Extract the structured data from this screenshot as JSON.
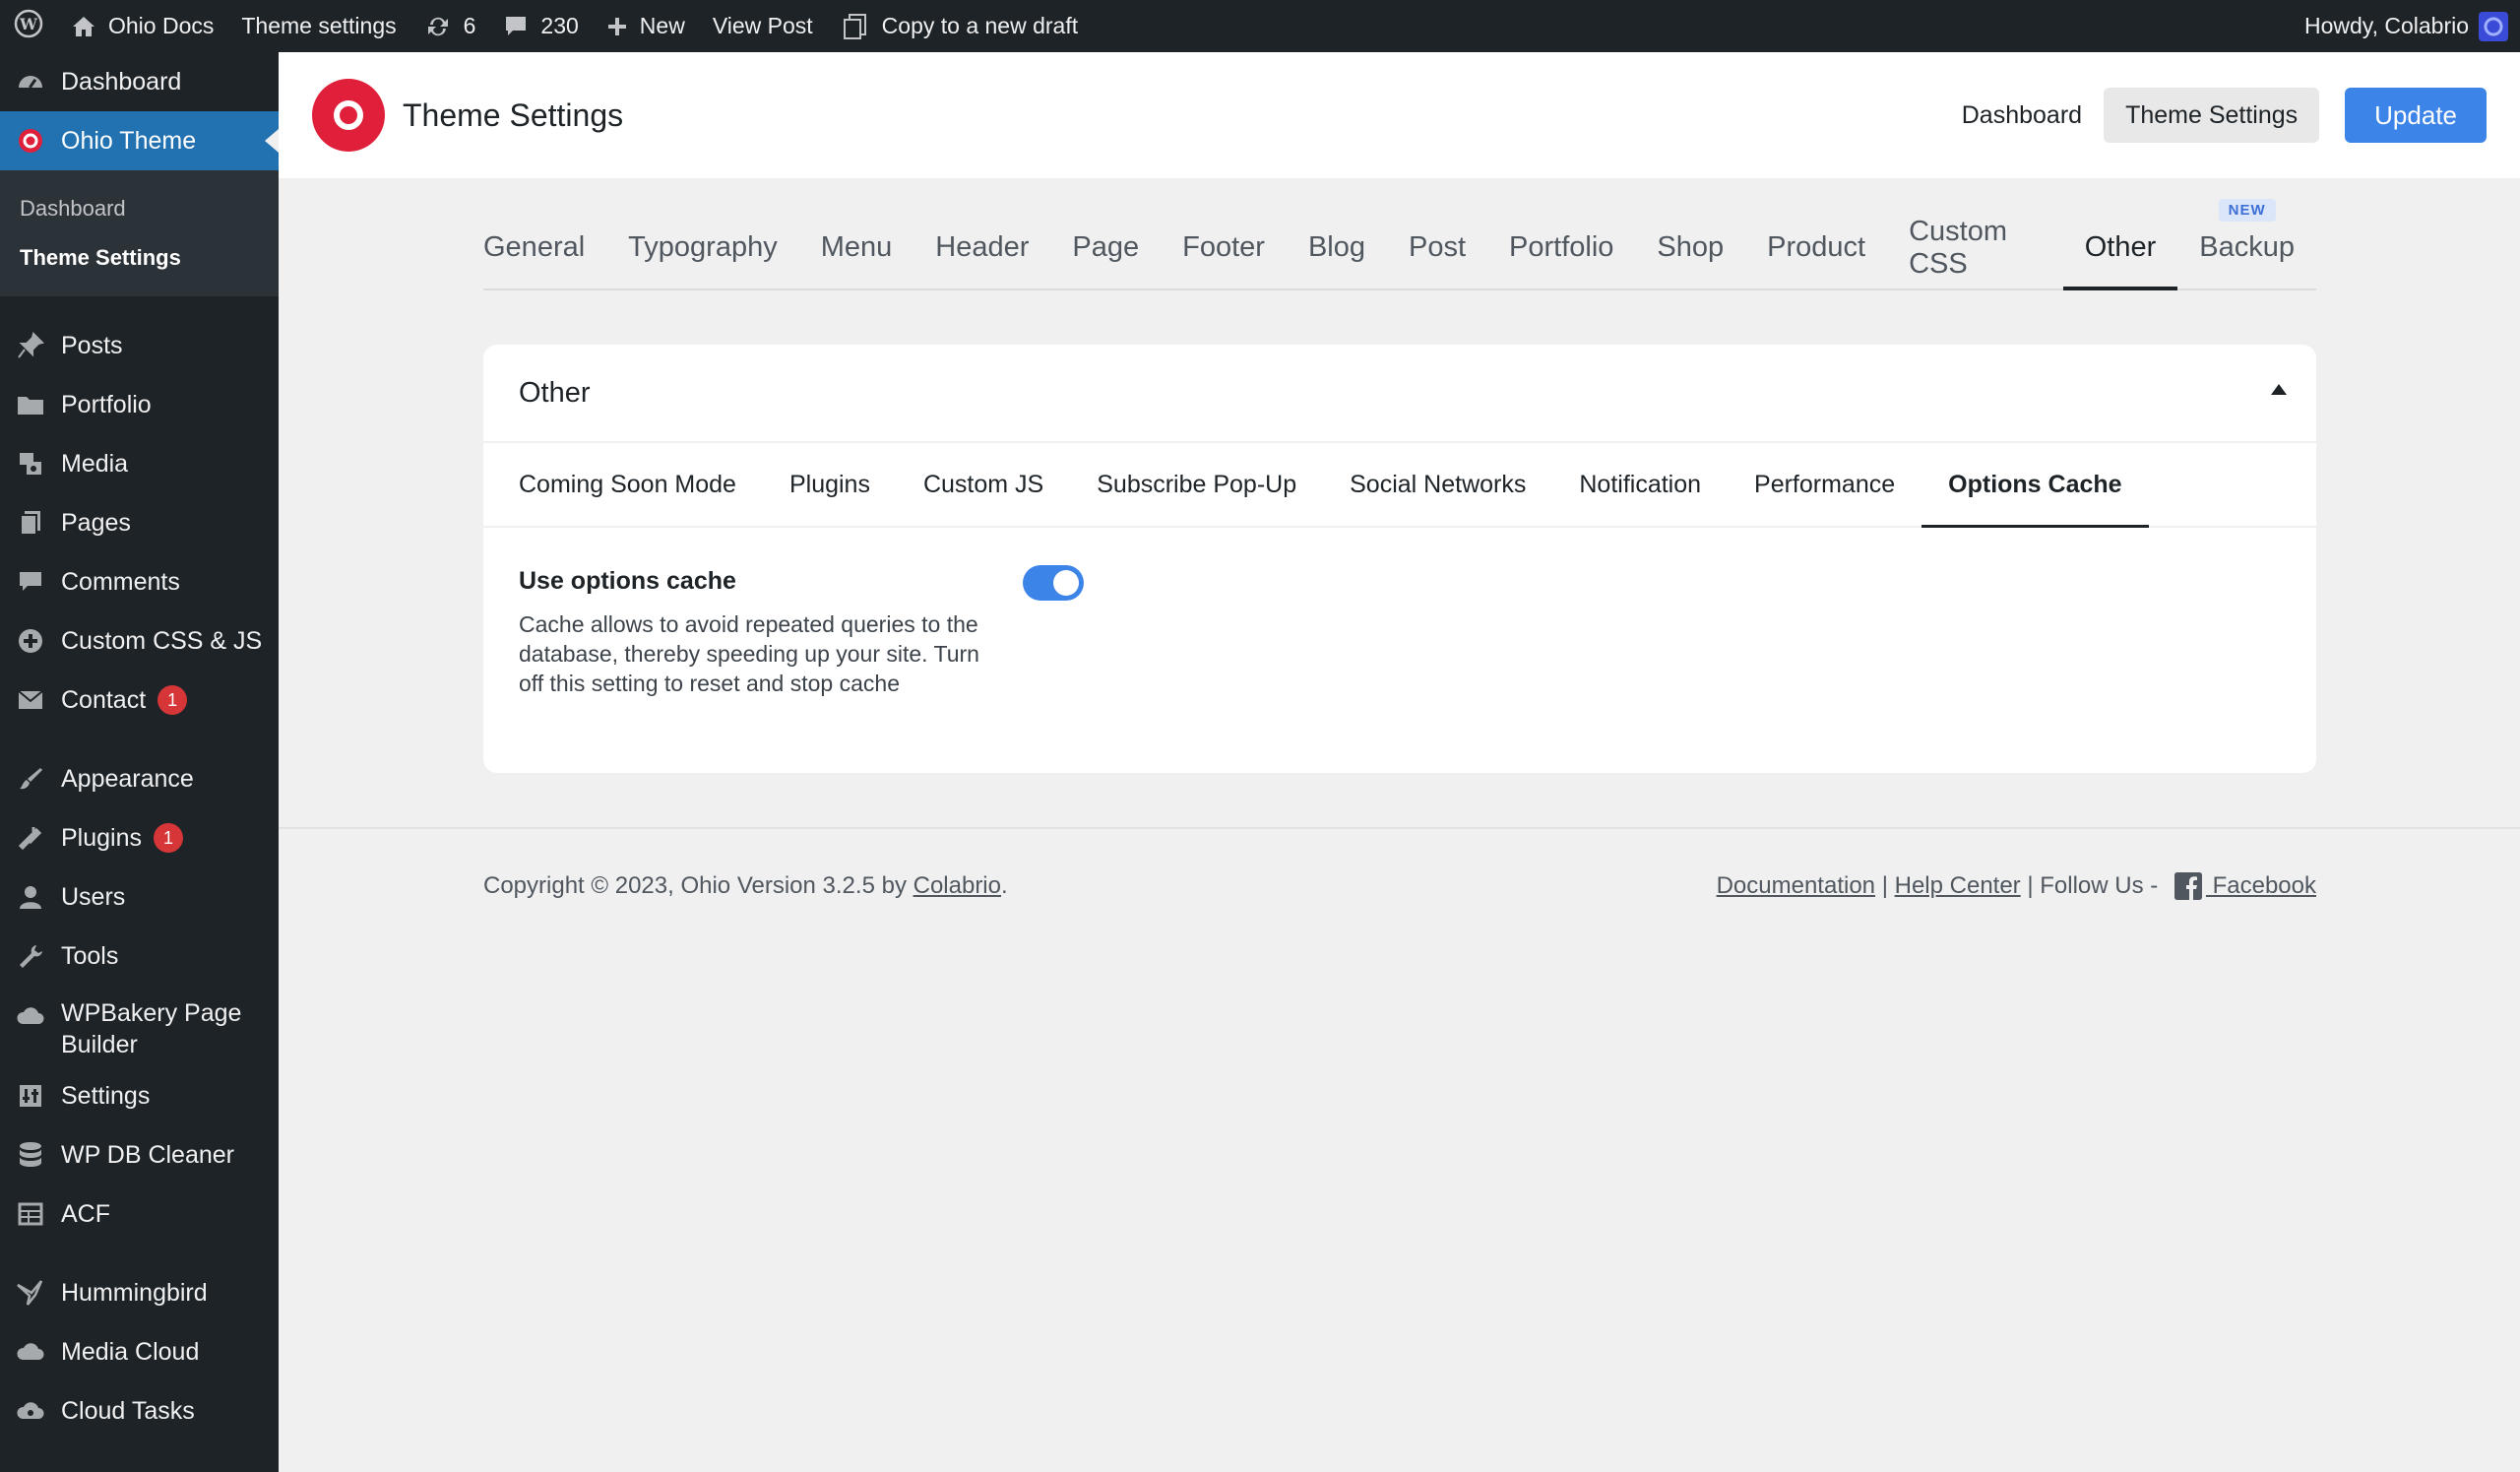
{
  "adminbar": {
    "site_name": "Ohio Docs",
    "theme_settings": "Theme settings",
    "updates_count": "6",
    "comments_count": "230",
    "new_label": "New",
    "view_post": "View Post",
    "copy_draft": "Copy to a new draft",
    "howdy": "Howdy, Colabrio"
  },
  "sidebar": {
    "items": [
      {
        "label": "Dashboard",
        "icon": "dashboard-icon"
      },
      {
        "label": "Ohio Theme",
        "icon": "ohio-logo-icon"
      },
      {
        "label": "Posts",
        "icon": "pin-icon"
      },
      {
        "label": "Portfolio",
        "icon": "folder-icon"
      },
      {
        "label": "Media",
        "icon": "media-icon"
      },
      {
        "label": "Pages",
        "icon": "pages-icon"
      },
      {
        "label": "Comments",
        "icon": "comment-icon"
      },
      {
        "label": "Custom CSS & JS",
        "icon": "plus-circle-icon"
      },
      {
        "label": "Contact",
        "icon": "mail-icon",
        "badge": "1"
      },
      {
        "label": "Appearance",
        "icon": "brush-icon"
      },
      {
        "label": "Plugins",
        "icon": "plug-icon",
        "badge": "1"
      },
      {
        "label": "Users",
        "icon": "user-icon"
      },
      {
        "label": "Tools",
        "icon": "wrench-icon"
      },
      {
        "label": "WPBakery Page Builder",
        "icon": "cloud-icon"
      },
      {
        "label": "Settings",
        "icon": "settings-icon"
      },
      {
        "label": "WP DB Cleaner",
        "icon": "database-icon"
      },
      {
        "label": "ACF",
        "icon": "table-icon"
      },
      {
        "label": "Hummingbird",
        "icon": "bird-icon"
      },
      {
        "label": "Media Cloud",
        "icon": "cloud-icon"
      },
      {
        "label": "Cloud Tasks",
        "icon": "gear-cloud-icon"
      }
    ],
    "submenu": [
      "Dashboard",
      "Theme Settings"
    ]
  },
  "header": {
    "title": "Theme Settings",
    "nav_dashboard": "Dashboard",
    "nav_theme_settings": "Theme Settings",
    "update_label": "Update"
  },
  "main_tabs": [
    "General",
    "Typography",
    "Menu",
    "Header",
    "Page",
    "Footer",
    "Blog",
    "Post",
    "Portfolio",
    "Shop",
    "Product",
    "Custom CSS",
    "Other",
    "Backup"
  ],
  "new_badge": "NEW",
  "card": {
    "title": "Other",
    "subtabs": [
      "Coming Soon Mode",
      "Plugins",
      "Custom JS",
      "Subscribe Pop-Up",
      "Social Networks",
      "Notification",
      "Performance",
      "Options Cache"
    ],
    "setting_label": "Use options cache",
    "setting_desc": "Cache allows to avoid repeated queries to the database, thereby speeding up your site. Turn off this setting to reset and stop cache",
    "toggle_on": true
  },
  "footer": {
    "copyright": "Copyright © 2023, Ohio Version 3.2.5 by ",
    "author": "Colabrio",
    "period": ".",
    "documentation": "Documentation",
    "sep1": " | ",
    "help_center": "Help Center",
    "follow": " | Follow Us - ",
    "facebook": " Facebook"
  },
  "colors": {
    "accent": "#3d84e9",
    "admin_bg": "#1d2327",
    "active_menu": "#2271b1",
    "brand": "#e0203b"
  }
}
